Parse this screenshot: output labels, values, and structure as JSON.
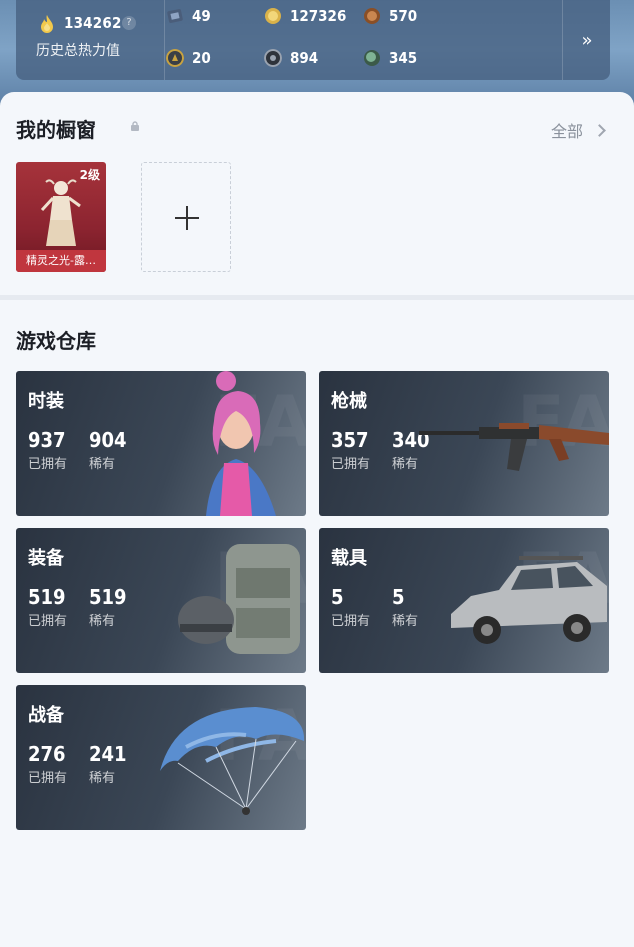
{
  "header": {
    "heat_value": "134262",
    "help_symbol": "?",
    "heat_label": "历史总热力值",
    "currencies": [
      {
        "icon": "ticket-icon",
        "value": "49",
        "color": "#5a6e8a"
      },
      {
        "icon": "gold-coin-icon",
        "value": "127326",
        "color": "#d9b24a"
      },
      {
        "icon": "bronze-coin-icon",
        "value": "570",
        "color": "#b8743e"
      },
      {
        "icon": "emblem-coin-icon",
        "value": "20",
        "color": "#c9a340"
      },
      {
        "icon": "silver-coin-icon",
        "value": "894",
        "color": "#7d8898"
      },
      {
        "icon": "green-orb-icon",
        "value": "345",
        "color": "#5f8f72"
      }
    ],
    "more_symbol": "»"
  },
  "showcase": {
    "title": "我的橱窗",
    "all_label": "全部",
    "item": {
      "level": "2级",
      "name": "精灵之光-露…"
    }
  },
  "warehouse": {
    "title": "游戏仓库",
    "cards": [
      {
        "title": "时装",
        "owned": "937",
        "rare": "904",
        "owned_label": "已拥有",
        "rare_label": "稀有"
      },
      {
        "title": "枪械",
        "owned": "357",
        "rare": "340",
        "owned_label": "已拥有",
        "rare_label": "稀有"
      },
      {
        "title": "装备",
        "owned": "519",
        "rare": "519",
        "owned_label": "已拥有",
        "rare_label": "稀有"
      },
      {
        "title": "载具",
        "owned": "5",
        "rare": "5",
        "owned_label": "已拥有",
        "rare_label": "稀有"
      },
      {
        "title": "战备",
        "owned": "276",
        "rare": "241",
        "owned_label": "已拥有",
        "rare_label": "稀有"
      }
    ]
  }
}
